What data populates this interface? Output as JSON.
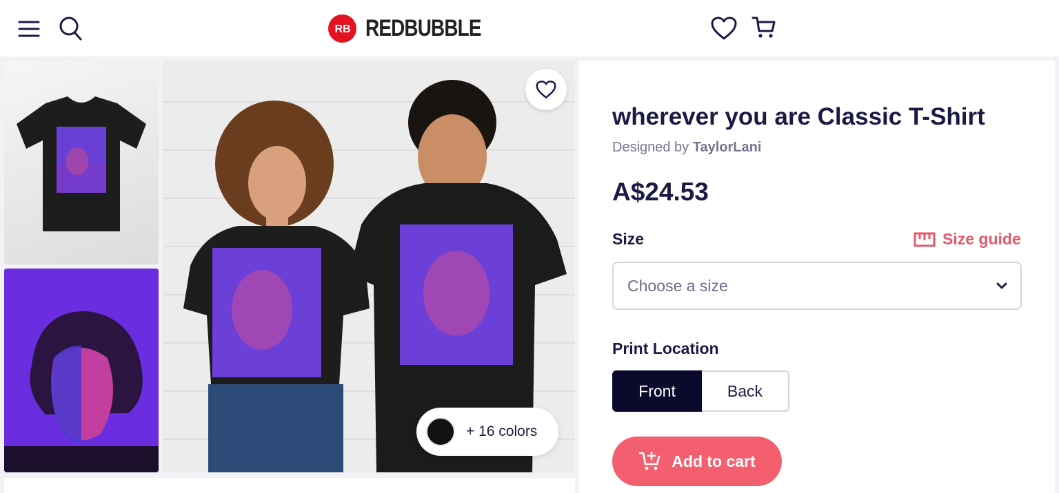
{
  "header": {
    "brand": "REDBUBBLE",
    "brand_badge": "RB",
    "icons": [
      "menu-icon",
      "search-icon",
      "heart-icon",
      "cart-icon"
    ]
  },
  "gallery": {
    "colors_label": "+ 16 colors",
    "selected_color": "#111111"
  },
  "product": {
    "title": "wherever you are Classic T-Shirt",
    "designed_by_prefix": "Designed by",
    "designer": "TaylorLani",
    "price": "A$24.53",
    "size_label": "Size",
    "size_guide_label": "Size guide",
    "size_placeholder": "Choose a size",
    "print_location_label": "Print Location",
    "print_options": [
      "Front",
      "Back"
    ],
    "selected_print": "Front",
    "add_to_cart_label": "Add to cart"
  },
  "colors": {
    "brand_red": "#e41321",
    "accent_pink": "#f35f6f",
    "navy": "#1b1a47"
  }
}
